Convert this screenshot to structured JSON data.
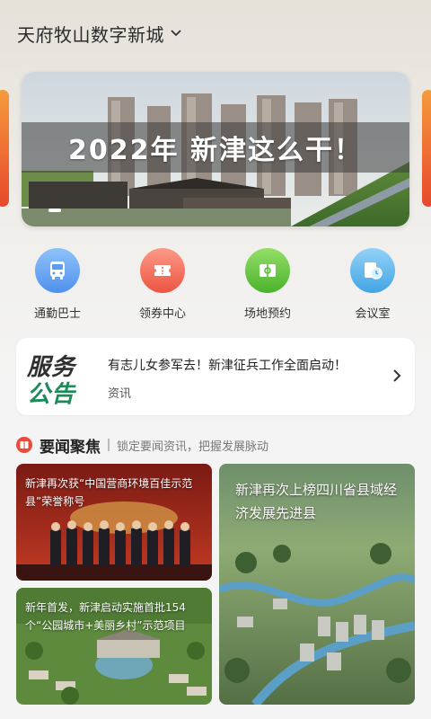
{
  "header": {
    "title": "天府牧山数字新城",
    "dropdown_icon": "chevron-down-icon"
  },
  "banner": {
    "headline": "2022年 新津这么干！",
    "slides_count": 5,
    "active_slide": 1
  },
  "quick_actions": [
    {
      "label": "通勤巴士",
      "icon": "bus-icon",
      "color": "#5aa0f0"
    },
    {
      "label": "领券中心",
      "icon": "coupon-icon",
      "color": "#f0685a"
    },
    {
      "label": "场地预约",
      "icon": "venue-icon",
      "color": "#63c93f"
    },
    {
      "label": "会议室",
      "icon": "meeting-room-icon",
      "color": "#62b7ec"
    }
  ],
  "notice": {
    "logo_line1": "服务",
    "logo_line2": "公告",
    "message": "有志儿女参军去！新津征兵工作全面启动！",
    "tag": "资讯",
    "arrow_icon": "chevron-right-icon"
  },
  "news": {
    "title": "要闻聚焦",
    "subtitle": "锁定要闻资讯，把握发展脉动",
    "icon": "news-book-icon",
    "items": [
      {
        "caption": "新津再次获“中国营商环境百佳示范县”荣誉称号"
      },
      {
        "caption": "新年首发，新津启动实施首批154个“公园城市+美丽乡村”示范项目"
      },
      {
        "caption": "新津再次上榜四川省县域经济发展先进县"
      }
    ]
  }
}
